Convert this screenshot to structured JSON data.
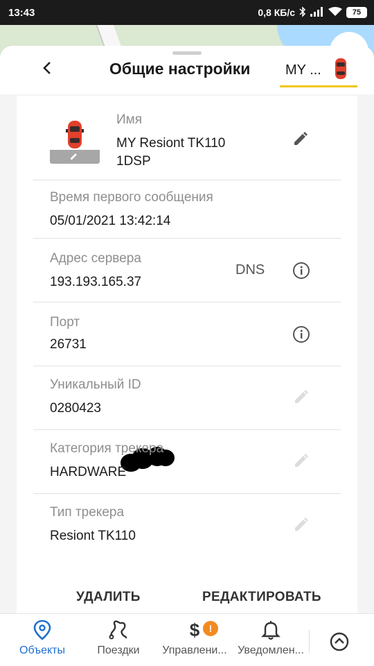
{
  "status_bar": {
    "time": "13:43",
    "speed": "0,8 КБ/с",
    "battery": "75"
  },
  "header": {
    "title": "Общие настройки",
    "object_tab_label": "MY ..."
  },
  "fields": {
    "name": {
      "label": "Имя",
      "value": "MY Resiont TK110 1DSP"
    },
    "first_message_time": {
      "label": "Время первого сообщения",
      "value": "05/01/2021 13:42:14"
    },
    "server_address": {
      "label": "Адрес сервера",
      "value": "193.193.165.37",
      "tag": "DNS"
    },
    "port": {
      "label": "Порт",
      "value": "26731"
    },
    "unique_id": {
      "label": "Уникальный ID",
      "value": "0280423"
    },
    "tracker_category": {
      "label": "Категория трекера",
      "value": "HARDWARE"
    },
    "tracker_type": {
      "label": "Тип трекера",
      "value": "Resiont TK110"
    }
  },
  "actions": {
    "delete_label": "УДАЛИТЬ",
    "edit_label": "РЕДАКТИРОВАТЬ"
  },
  "bottom_nav": {
    "items": [
      {
        "label": "Объекты",
        "icon": "location-pin-icon",
        "active": true
      },
      {
        "label": "Поездки",
        "icon": "route-icon",
        "active": false
      },
      {
        "label": "Управлени...",
        "icon": "dollar-icon",
        "active": false,
        "badge": "!"
      },
      {
        "label": "Уведомлен...",
        "icon": "bell-icon",
        "active": false
      }
    ]
  },
  "colors": {
    "accent_yellow": "#f2c614",
    "active_blue": "#1e6fd0",
    "badge_orange": "#f28a22",
    "car_red": "#e0402c"
  }
}
